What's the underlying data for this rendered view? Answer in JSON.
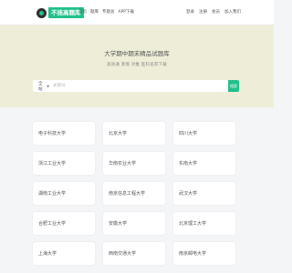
{
  "header": {
    "logo_text": "不挂高题库",
    "nav": [
      "首页",
      "题库",
      "专题总",
      "APP下载"
    ],
    "user_links": [
      "登录",
      "注册",
      "会员",
      "加入我们"
    ]
  },
  "hero": {
    "title": "大学期中期末精品试题库",
    "subtitle": "高效通  蒸馏  对推  医科名荐下载"
  },
  "search": {
    "scope": "全站",
    "placeholder": "关键词",
    "button": "搜索"
  },
  "universities": [
    "电子科技大学",
    "北京大学",
    "四川大学",
    "浙江工业大学",
    "华南农业大学",
    "东南大学",
    "湖南工业大学",
    "南京信息工程大学",
    "武汉大学",
    "合肥工业大学",
    "安徽大学",
    "北京理工大学",
    "上海大学",
    "西南交通大学",
    "南京邮电大学"
  ],
  "colors": {
    "accent": "#22c08a",
    "hero_bg": "#eeeed8",
    "page_bg": "#f4f5f7"
  }
}
